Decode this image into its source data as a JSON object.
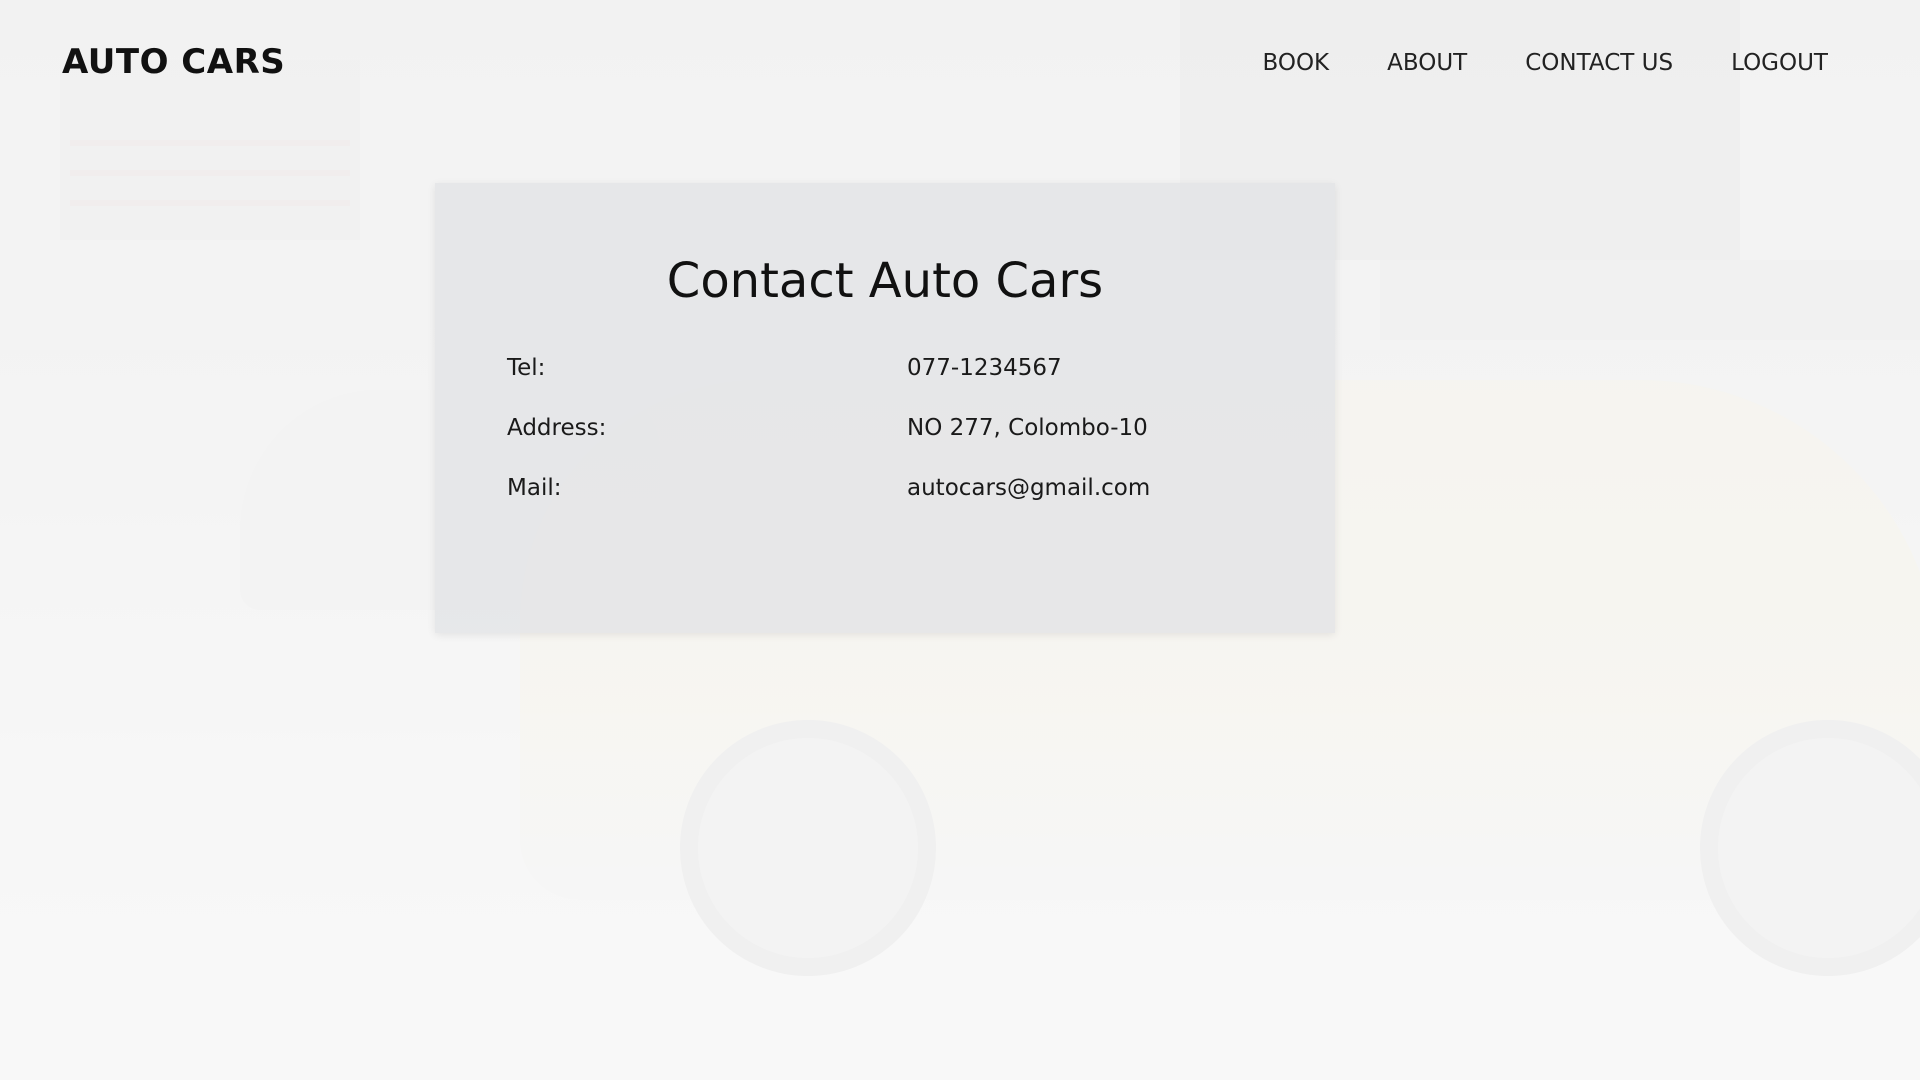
{
  "header": {
    "logo": "AUTO CARS",
    "nav": [
      {
        "label": "BOOK"
      },
      {
        "label": "ABOUT"
      },
      {
        "label": "CONTACT US"
      },
      {
        "label": "LOGOUT"
      }
    ]
  },
  "contact": {
    "title": "Contact Auto Cars",
    "rows": [
      {
        "label": "Tel:",
        "value": "077-1234567"
      },
      {
        "label": "Address:",
        "value": "NO 277, Colombo-10"
      },
      {
        "label": "Mail:",
        "value": "autocars@gmail.com"
      }
    ]
  },
  "colors": {
    "text": "#111111",
    "card_background": "#e1e2e4",
    "page_background": "#f4f4f4"
  }
}
